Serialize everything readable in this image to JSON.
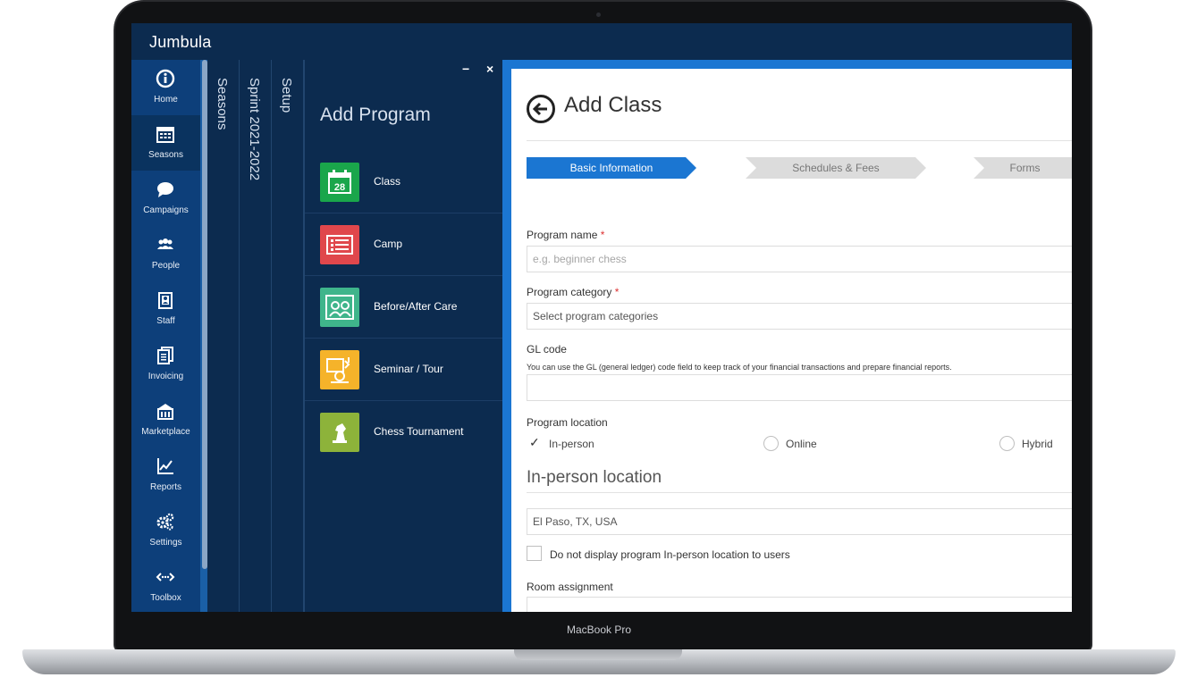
{
  "device": {
    "model_label": "MacBook Pro"
  },
  "app": {
    "brand": "Jumbula"
  },
  "nav": {
    "items": [
      {
        "label": "Home",
        "icon": "info-circle-icon"
      },
      {
        "label": "Seasons",
        "icon": "calendar-icon",
        "active": true
      },
      {
        "label": "Campaigns",
        "icon": "chat-bubble-icon"
      },
      {
        "label": "People",
        "icon": "people-icon"
      },
      {
        "label": "Staff",
        "icon": "staff-badge-icon"
      },
      {
        "label": "Invoicing",
        "icon": "invoice-icon"
      },
      {
        "label": "Marketplace",
        "icon": "marketplace-icon"
      },
      {
        "label": "Reports",
        "icon": "chart-line-icon"
      },
      {
        "label": "Settings",
        "icon": "gears-icon"
      },
      {
        "label": "Toolbox",
        "icon": "toolbox-icon"
      }
    ]
  },
  "vtabs": [
    "Seasons",
    "Sprint 2021-2022",
    "Setup"
  ],
  "add_program": {
    "title": "Add Program",
    "minimize": "−",
    "close": "×",
    "items": [
      {
        "label": "Class",
        "icon": "calendar-28-icon",
        "color": "#1aa64b",
        "icon_text": "28"
      },
      {
        "label": "Camp",
        "icon": "camp-list-icon",
        "color": "#e0474c"
      },
      {
        "label": "Before/After Care",
        "icon": "care-icon",
        "color": "#3fb58b"
      },
      {
        "label": "Seminar / Tour",
        "icon": "seminar-icon",
        "color": "#f5b32a"
      },
      {
        "label": "Chess Tournament",
        "icon": "chess-icon",
        "color": "#8db33a"
      }
    ]
  },
  "form": {
    "title": "Add Class",
    "steps": [
      "Basic Information",
      "Schedules & Fees",
      "Forms"
    ],
    "program_name": {
      "label": "Program name",
      "required": "*",
      "placeholder": "e.g. beginner chess"
    },
    "program_category": {
      "label": "Program category",
      "required": "*",
      "placeholder": "Select program categories"
    },
    "gl_code": {
      "label": "GL code",
      "help": "You can use the GL (general ledger) code field to keep track of your financial transactions and prepare financial reports.",
      "value": ""
    },
    "program_location": {
      "label": "Program location",
      "options": [
        "In-person",
        "Online",
        "Hybrid"
      ],
      "selected": "In-person"
    },
    "in_person_location": {
      "title": "In-person location",
      "value": "El Paso, TX, USA"
    },
    "hide_location": {
      "label": "Do not display program In-person location to users",
      "checked": false
    },
    "room_assignment": {
      "label": "Room assignment",
      "value": ""
    }
  },
  "colors": {
    "header": "#0c2b4f",
    "nav": "#0d3f7a",
    "accent": "#1b76d2"
  }
}
